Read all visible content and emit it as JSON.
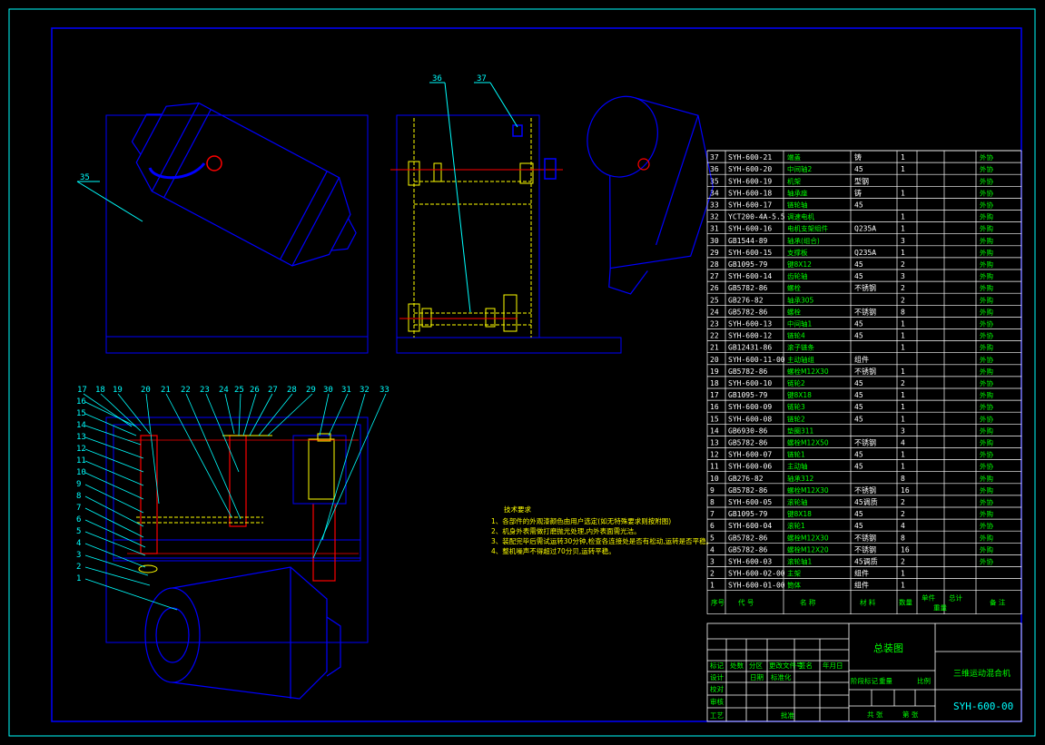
{
  "colors": {
    "background": "#000000",
    "frame": "#0000ff",
    "outer_border": "#00ffff",
    "leader": "#00ffff",
    "hidden_lines": "#ffff00",
    "centerline": "#ff0000",
    "table_text": "#ffffff",
    "table_highlight": "#00ff00",
    "notes_text": "#ffff00"
  },
  "views": {
    "top_left_label": "35",
    "top_middle_labels": [
      "36",
      "37"
    ],
    "bottom_left_labels_top": [
      "17",
      "18",
      "19",
      "20",
      "21",
      "22",
      "23",
      "24",
      "25",
      "26",
      "27",
      "28",
      "29",
      "30",
      "31",
      "32",
      "33"
    ],
    "bottom_left_labels_left": [
      "16",
      "15",
      "14",
      "13",
      "12",
      "11",
      "10",
      "9",
      "8",
      "7",
      "6",
      "5",
      "4",
      "3",
      "2",
      "1"
    ]
  },
  "notes": {
    "title": "技术要求",
    "items": [
      "1、各部件的外观漆颜色由用户选定(如无特殊要求则按附图)",
      "2、机身外表需做打磨抛光处理,内外表面需光洁。",
      "3、装配完毕后需试运转30分钟,检查各连接处是否有松动,运转是否平稳。",
      "4、整机噪声不得超过70分贝,运转平稳。"
    ]
  },
  "bom": {
    "rows": [
      {
        "no": "37",
        "code": "SYH-600-21",
        "name": "端盖",
        "qty": "1",
        "material": "铸",
        "note": "外协"
      },
      {
        "no": "36",
        "code": "SYH-600-20",
        "name": "中间轴2",
        "qty": "1",
        "material": "45",
        "note": "外协"
      },
      {
        "no": "35",
        "code": "SYH-600-19",
        "name": "机架",
        "qty": "",
        "material": "型钢",
        "note": "外协"
      },
      {
        "no": "34",
        "code": "SYH-600-18",
        "name": "轴承座",
        "qty": "1",
        "material": "铸",
        "note": "外协"
      },
      {
        "no": "33",
        "code": "SYH-600-17",
        "name": "链轮轴",
        "qty": "",
        "material": "45",
        "note": "外协"
      },
      {
        "no": "32",
        "code": "YCT200-4A-5.5",
        "name": "调速电机",
        "qty": "1",
        "material": "",
        "note": "外购"
      },
      {
        "no": "31",
        "code": "SYH-600-16",
        "name": "电机支架组件",
        "qty": "1",
        "material": "Q235A",
        "note": "外购"
      },
      {
        "no": "30",
        "code": "GB1544-89",
        "name": "轴承(组合)",
        "qty": "3",
        "material": "",
        "note": "外购"
      },
      {
        "no": "29",
        "code": "SYH-600-15",
        "name": "支撑板",
        "qty": "1",
        "material": "Q235A",
        "note": "外购"
      },
      {
        "no": "28",
        "code": "GB1095-79",
        "name": "键8X12",
        "qty": "2",
        "material": "45",
        "note": "外购"
      },
      {
        "no": "27",
        "code": "SYH-600-14",
        "name": "齿轮轴",
        "qty": "3",
        "material": "45",
        "note": "外购"
      },
      {
        "no": "26",
        "code": "GB5782-86",
        "name": "螺栓",
        "qty": "2",
        "material": "不锈钢",
        "note": "外购"
      },
      {
        "no": "25",
        "code": "GB276-82",
        "name": "轴承305",
        "qty": "2",
        "material": "",
        "note": "外购"
      },
      {
        "no": "24",
        "code": "GB5782-86",
        "name": "螺栓",
        "qty": "8",
        "material": "不锈钢",
        "note": "外购"
      },
      {
        "no": "23",
        "code": "SYH-600-13",
        "name": "中间轴1",
        "qty": "1",
        "material": "45",
        "note": "外协"
      },
      {
        "no": "22",
        "code": "SYH-600-12",
        "name": "链轮4",
        "qty": "1",
        "material": "45",
        "note": "外协"
      },
      {
        "no": "21",
        "code": "GB12431-86",
        "name": "滚子链条",
        "qty": "1",
        "material": "",
        "note": "外购"
      },
      {
        "no": "20",
        "code": "SYH-600-11-00",
        "name": "主动轴组",
        "qty": "",
        "material": "组件",
        "note": "外协"
      },
      {
        "no": "19",
        "code": "GB5782-86",
        "name": "螺栓M12X30",
        "qty": "1",
        "material": "不锈钢",
        "note": "外购"
      },
      {
        "no": "18",
        "code": "SYH-600-10",
        "name": "链轮2",
        "qty": "2",
        "material": "45",
        "note": "外协"
      },
      {
        "no": "17",
        "code": "GB1095-79",
        "name": "键8X18",
        "qty": "1",
        "material": "45",
        "note": "外购"
      },
      {
        "no": "16",
        "code": "SYH-600-09",
        "name": "链轮3",
        "qty": "1",
        "material": "45",
        "note": "外协"
      },
      {
        "no": "15",
        "code": "SYH-600-08",
        "name": "链轮2",
        "qty": "1",
        "material": "45",
        "note": "外协"
      },
      {
        "no": "14",
        "code": "GB6930-86",
        "name": "垫圈311",
        "qty": "3",
        "material": "",
        "note": "外购"
      },
      {
        "no": "13",
        "code": "GB5782-86",
        "name": "螺栓M12X50",
        "qty": "4",
        "material": "不锈钢",
        "note": "外购"
      },
      {
        "no": "12",
        "code": "SYH-600-07",
        "name": "链轮1",
        "qty": "1",
        "material": "45",
        "note": "外协"
      },
      {
        "no": "11",
        "code": "SYH-600-06",
        "name": "主动轴",
        "qty": "1",
        "material": "45",
        "note": "外协"
      },
      {
        "no": "10",
        "code": "GB276-82",
        "name": "轴承312",
        "qty": "8",
        "material": "",
        "note": "外购"
      },
      {
        "no": "9",
        "code": "GB5782-86",
        "name": "螺栓M12X30",
        "qty": "16",
        "material": "不锈钢",
        "note": "外购"
      },
      {
        "no": "8",
        "code": "SYH-600-05",
        "name": "滚轮轴",
        "qty": "2",
        "material": "45调质",
        "note": "外协"
      },
      {
        "no": "7",
        "code": "GB1095-79",
        "name": "键8X18",
        "qty": "2",
        "material": "45",
        "note": "外购"
      },
      {
        "no": "6",
        "code": "SYH-600-04",
        "name": "滚轮1",
        "qty": "4",
        "material": "45",
        "note": "外协"
      },
      {
        "no": "5",
        "code": "GB5782-86",
        "name": "螺栓M12X30",
        "qty": "8",
        "material": "不锈钢",
        "note": "外购"
      },
      {
        "no": "4",
        "code": "GB5782-86",
        "name": "螺栓M12X20",
        "qty": "16",
        "material": "不锈钢",
        "note": "外购"
      },
      {
        "no": "3",
        "code": "SYH-600-03",
        "name": "滚轮轴1",
        "qty": "2",
        "material": "45调质",
        "note": "外协"
      },
      {
        "no": "2",
        "code": "SYH-600-02-00",
        "name": "主架",
        "qty": "1",
        "material": "组件",
        "note": ""
      },
      {
        "no": "1",
        "code": "SYH-600-01-00",
        "name": "筒体",
        "qty": "1",
        "material": "组件",
        "note": ""
      }
    ],
    "header": {
      "no": "序号",
      "code": "代  号",
      "name": "名  称",
      "qty": "数量",
      "material": "材  料",
      "single": "单件",
      "total": "总计",
      "weight": "重量",
      "note": "备  注"
    }
  },
  "title_block": {
    "drawing_title": "总装图",
    "machine_name": "三维运动混合机",
    "drawing_no": "SYH-600-00",
    "row_labels": [
      "标记",
      "处数",
      "分区",
      "更改文件号",
      "签名",
      "年月日"
    ],
    "roles": [
      "设计",
      "校对",
      "审核",
      "工艺"
    ],
    "standardize": "标准化",
    "approve": "批准",
    "date_label": "日期",
    "stage_label": "阶段标记",
    "weight_label": "重量",
    "scale_label": "比例",
    "sheet_total": "共  张",
    "sheet_no": "第  张"
  }
}
